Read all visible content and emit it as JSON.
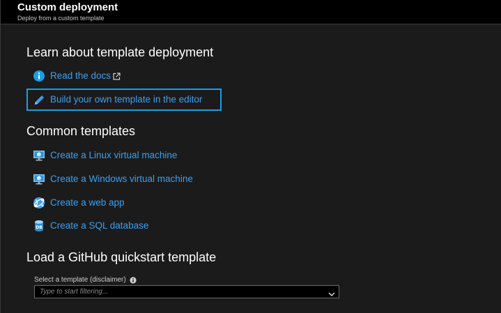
{
  "header": {
    "title": "Custom deployment",
    "subtitle": "Deploy from a custom template"
  },
  "learn": {
    "heading": "Learn about template deployment",
    "read_docs": "Read the docs",
    "build_editor": "Build your own template in the editor"
  },
  "common": {
    "heading": "Common templates",
    "items": [
      {
        "label": "Create a Linux virtual machine",
        "icon": "vm-icon"
      },
      {
        "label": "Create a Windows virtual machine",
        "icon": "vm-icon"
      },
      {
        "label": "Create a web app",
        "icon": "web-app-icon"
      },
      {
        "label": "Create a SQL database",
        "icon": "sql-database-icon"
      }
    ]
  },
  "github": {
    "heading": "Load a GitHub quickstart template",
    "select_label": "Select a template (disclaimer)",
    "select_placeholder": "Type to start filtering..."
  },
  "colors": {
    "link": "#3aa0f3",
    "focus": "#1a9ee8",
    "background": "#1b1b1b",
    "header": "#000000"
  }
}
